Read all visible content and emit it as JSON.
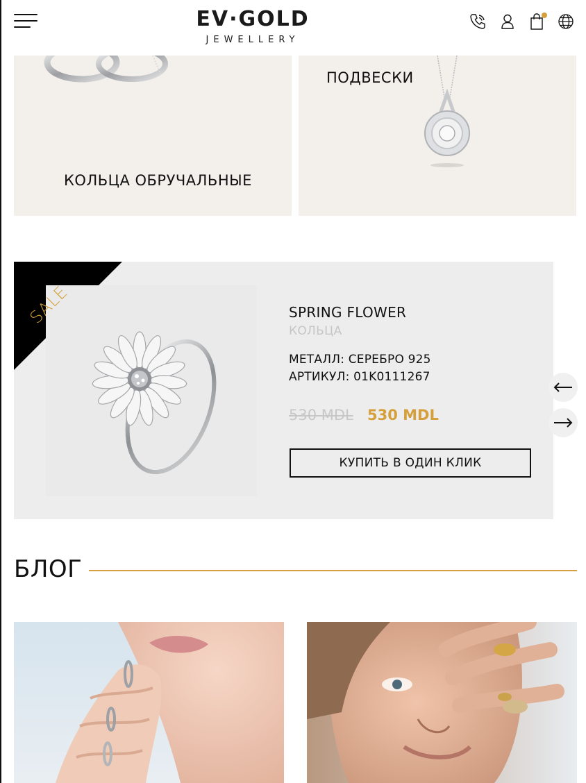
{
  "header": {
    "logo_main": "EV·GOLD",
    "logo_sub": "JEWELLERY",
    "icons": [
      "menu-icon",
      "phone-icon",
      "user-icon",
      "cart-icon",
      "globe-icon"
    ],
    "cart_indicator_color": "#d5a03c"
  },
  "categories": [
    {
      "label": "КОЛЬЦА ОБРУЧАЛЬНЫЕ"
    },
    {
      "label": "ПОДВЕСКИ"
    }
  ],
  "product": {
    "badge": "SALE",
    "title": "SPRING FLOWER",
    "category": "КОЛЬЦА",
    "metal": "МЕТАЛЛ: СЕРЕБРО 925",
    "article": "АРТИКУЛ: 01K0111267",
    "price_old": "530 MDL",
    "price_new": "530 MDL",
    "buy_button": "КУПИТЬ В ОДИН КЛИК"
  },
  "slider": {
    "prev_icon": "arrow-left-icon",
    "next_icon": "arrow-right-icon"
  },
  "blog": {
    "title": "БЛОГ"
  },
  "colors": {
    "accent_gold": "#d5a03c",
    "tile_bg": "#f3efeb",
    "product_bg": "#ededed",
    "text": "#111111"
  }
}
